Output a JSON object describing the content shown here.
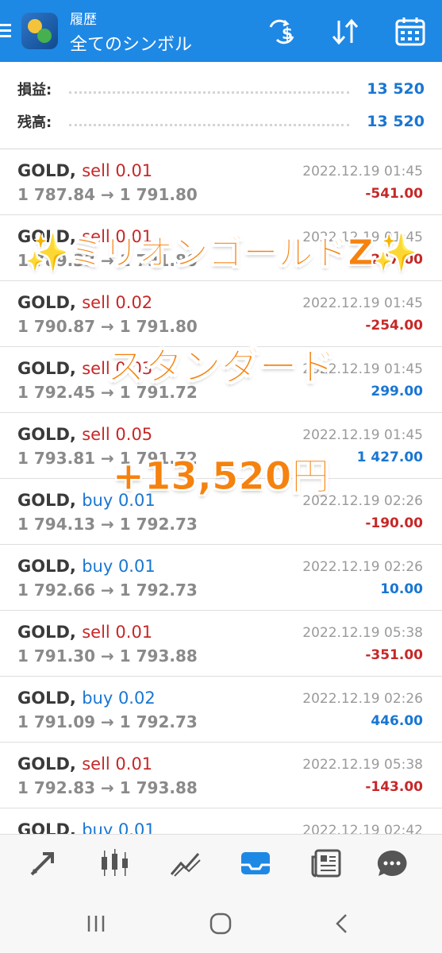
{
  "header": {
    "title_small": "履歴",
    "title_big": "全てのシンボル",
    "icons": [
      "menu-icon",
      "app-logo-icon",
      "currency-filter-icon",
      "sort-icon",
      "calendar-icon"
    ]
  },
  "summary": {
    "profit_label": "損益:",
    "profit_value": "13 520",
    "balance_label": "残高:",
    "balance_value": "13 520"
  },
  "trades": [
    {
      "symbol": "GOLD,",
      "side": "sell 0.01",
      "prices": "1 787.84 → 1 791.80",
      "date": "2022.12.19 01:45",
      "profit": "-541.00"
    },
    {
      "symbol": "GOLD,",
      "side": "sell 0.01",
      "prices": "1 789.33 → 1 791.80",
      "date": "2022.12.19 01:45",
      "profit": "-247.00"
    },
    {
      "symbol": "GOLD,",
      "side": "sell 0.02",
      "prices": "1 790.87 → 1 791.80",
      "date": "2022.12.19 01:45",
      "profit": "-254.00"
    },
    {
      "symbol": "GOLD,",
      "side": "sell 0.03",
      "prices": "1 792.45 → 1 791.72",
      "date": "2022.12.19 01:45",
      "profit": "299.00"
    },
    {
      "symbol": "GOLD,",
      "side": "sell 0.05",
      "prices": "1 793.81 → 1 791.72",
      "date": "2022.12.19 01:45",
      "profit": "1 427.00"
    },
    {
      "symbol": "GOLD,",
      "side": "buy 0.01",
      "prices": "1 794.13 → 1 792.73",
      "date": "2022.12.19 02:26",
      "profit": "-190.00"
    },
    {
      "symbol": "GOLD,",
      "side": "buy 0.01",
      "prices": "1 792.66 → 1 792.73",
      "date": "2022.12.19 02:26",
      "profit": "10.00"
    },
    {
      "symbol": "GOLD,",
      "side": "sell 0.01",
      "prices": "1 791.30 → 1 793.88",
      "date": "2022.12.19 05:38",
      "profit": "-351.00"
    },
    {
      "symbol": "GOLD,",
      "side": "buy 0.02",
      "prices": "1 791.09 → 1 792.73",
      "date": "2022.12.19 02:26",
      "profit": "446.00"
    },
    {
      "symbol": "GOLD,",
      "side": "sell 0.01",
      "prices": "1 792.83 → 1 793.88",
      "date": "2022.12.19 05:38",
      "profit": "-143.00"
    },
    {
      "symbol": "GOLD,",
      "side": "buy 0.01",
      "prices": "",
      "date": "2022.12.19 02:42",
      "profit": ""
    }
  ],
  "overlay": {
    "line1": "ミリオンゴールドZ",
    "line2": "スタンダード",
    "line3": "+13,520円",
    "sparkle": "✨"
  },
  "bottom_nav": [
    "trade-icon",
    "chart-candles-icon",
    "trend-icon",
    "history-tray-icon",
    "news-icon",
    "chat-icon"
  ],
  "colors": {
    "header_bg": "#1e88e5",
    "sell": "#c62828",
    "buy": "#1976d2",
    "overlay": "#f5820f"
  }
}
